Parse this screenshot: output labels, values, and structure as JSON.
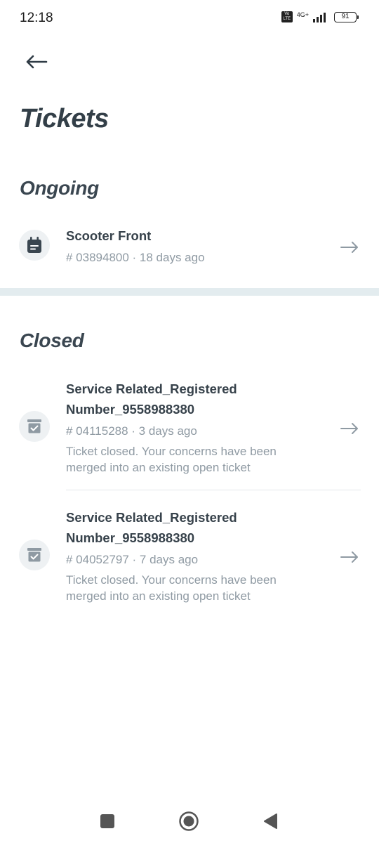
{
  "status_bar": {
    "time": "12:18",
    "volte": "Vo LTE",
    "network": "4G+",
    "battery": "91"
  },
  "header": {
    "back_icon": "arrow-left-icon",
    "title": "Tickets"
  },
  "ongoing": {
    "section_title": "Ongoing",
    "tickets": [
      {
        "icon": "calendar-icon",
        "title": "Scooter Front",
        "meta": "# 03894800 · 18 days ago"
      }
    ]
  },
  "closed": {
    "section_title": "Closed",
    "tickets": [
      {
        "icon": "archive-check-icon",
        "title_line1": "Service Related_Registered",
        "title_line2": "Number_9558988380",
        "meta": "# 04115288 · 3 days ago",
        "desc_line1": "Ticket closed. Your concerns have been",
        "desc_line2": "merged into an existing open ticket"
      },
      {
        "icon": "archive-check-icon",
        "title_line1": "Service Related_Registered",
        "title_line2": "Number_9558988380",
        "meta": "# 04052797 · 7 days ago",
        "desc_line1": "Ticket closed. Your concerns have been",
        "desc_line2": "merged into an existing open ticket"
      }
    ]
  },
  "colors": {
    "text_primary": "#37424b",
    "text_secondary": "#8f9aa3",
    "divider": "#e3ecef",
    "icon_bg": "#eef1f3"
  },
  "nav": {
    "recents_icon": "square-icon",
    "home_icon": "circle-home-icon",
    "back_icon": "triangle-back-icon"
  }
}
